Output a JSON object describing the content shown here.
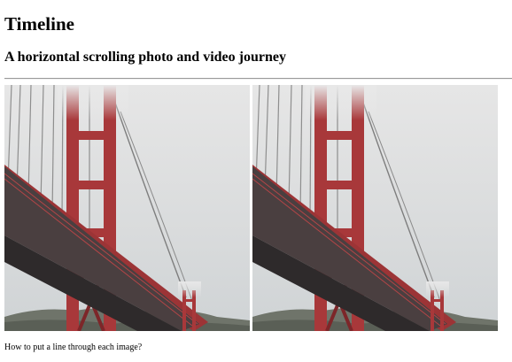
{
  "page": {
    "title": "Timeline",
    "subtitle": "A horizontal scrolling photo and video journey",
    "caption": "How to put a line through each image?"
  },
  "timeline": {
    "items": [
      {
        "icon": "golden-gate-bridge-photo"
      },
      {
        "icon": "golden-gate-bridge-photo"
      }
    ]
  },
  "colors": {
    "bridge_red": "#a8383a",
    "sky": "#dcdcdc",
    "deck_dark": "#3a3434",
    "rule": "#9a9a9a"
  }
}
